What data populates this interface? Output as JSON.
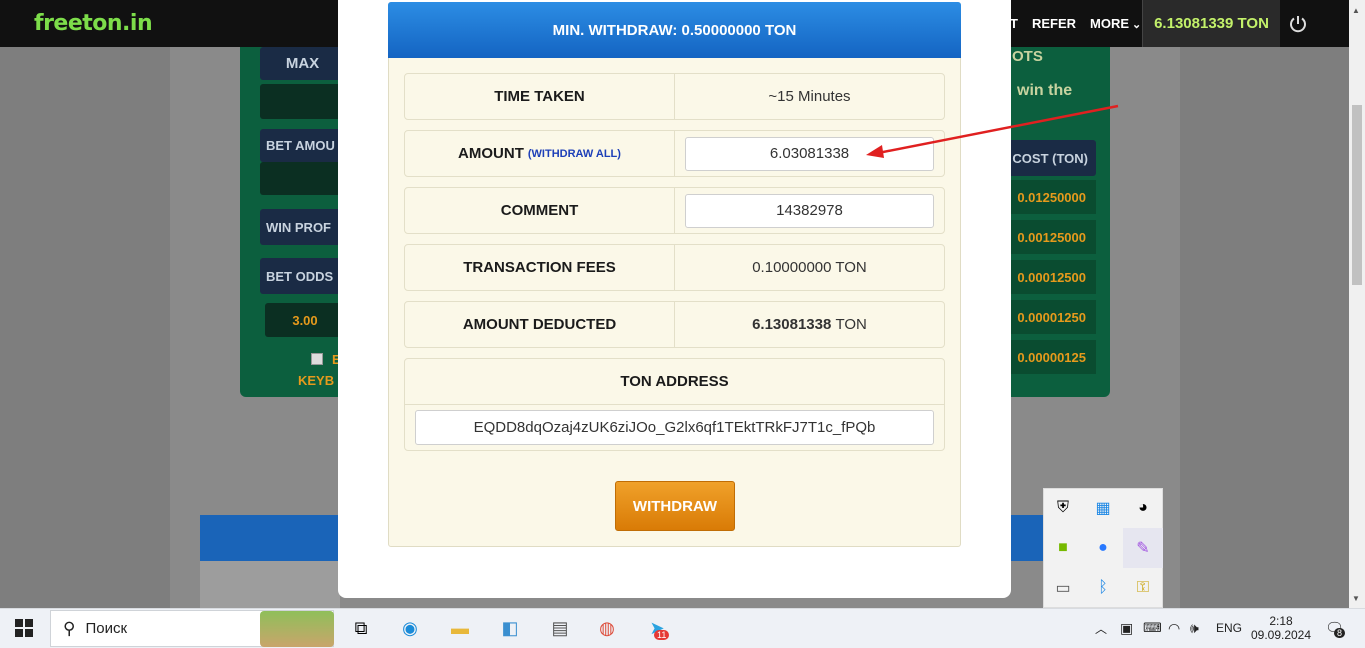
{
  "site": {
    "logo": "freeton.in",
    "nav": [
      "T",
      "REFER",
      "MORE"
    ],
    "balance": "6.13081339 TON",
    "power_icon": "power-icon"
  },
  "background": {
    "left_labels": [
      "MAX",
      "BET AMOU",
      "WIN PROF",
      "BET ODDS"
    ],
    "odds_value": "3.00",
    "keyb_label": "KEYB",
    "checkbox_label": "E",
    "right_texts": [
      "OTS",
      "win the"
    ],
    "cost_header": "COST (TON)",
    "costs": [
      "0.01250000",
      "0.00125000",
      "0.00012500",
      "0.00001250",
      "0.00000125"
    ]
  },
  "modal": {
    "header": "MIN. WITHDRAW: 0.50000000 TON",
    "time_taken_label": "TIME TAKEN",
    "time_taken_value": "~15 Minutes",
    "amount_label": "AMOUNT",
    "withdraw_all": "(WITHDRAW ALL)",
    "amount_value": "6.03081338",
    "comment_label": "COMMENT",
    "comment_value": "14382978",
    "fees_label": "TRANSACTION FEES",
    "fees_value": "0.10000000 TON",
    "deducted_label": "AMOUNT DEDUCTED",
    "deducted_amount": "6.13081338",
    "deducted_unit": "TON",
    "address_label": "TON ADDRESS",
    "address_value": "EQDD8dqOzaj4zUK6ziJOo_G2lx6qf1TEktTRkFJ7T1c_fPQb",
    "withdraw_button": "WITHDRAW"
  },
  "taskbar": {
    "search_placeholder": "Поиск",
    "lang": "ENG",
    "time": "2:18",
    "date": "09.09.2024",
    "notifications": "8",
    "telegram_badge": "11"
  },
  "colors": {
    "accent_blue": "#1a6fd0",
    "withdraw_orange": "#e8900f",
    "balance_green": "#c3f16a",
    "panel_green": "#0c5f3e",
    "arrow_red": "#e02020"
  }
}
